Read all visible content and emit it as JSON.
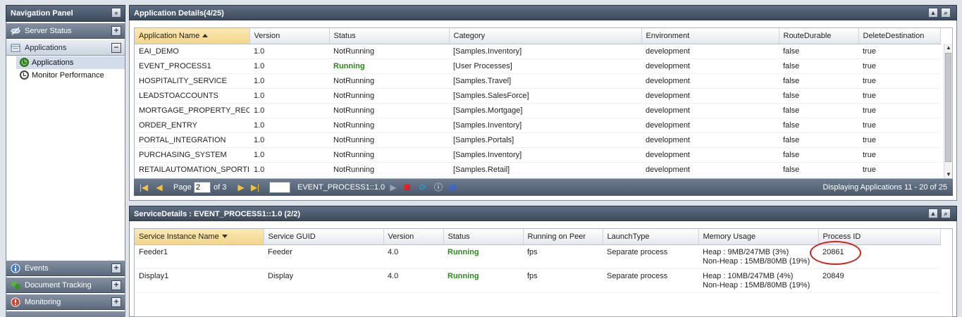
{
  "nav": {
    "title": "Navigation Panel",
    "sections": [
      {
        "label": "Server Status",
        "icon": "server-status-icon",
        "state": "+"
      },
      {
        "label": "Applications",
        "icon": "applications-icon",
        "state": "−"
      },
      {
        "label": "Events",
        "icon": "events-icon",
        "state": "+"
      },
      {
        "label": "Document Tracking",
        "icon": "document-tracking-icon",
        "state": "+"
      },
      {
        "label": "Monitoring",
        "icon": "monitoring-icon",
        "state": "+"
      }
    ],
    "items": [
      {
        "label": "Applications",
        "icon": "clock-icon",
        "selected": true
      },
      {
        "label": "Monitor Performance",
        "icon": "clock-icon",
        "selected": false
      }
    ]
  },
  "app_panel": {
    "title": "Application Details(4/25)",
    "columns": [
      "Application Name",
      "Version",
      "Status",
      "Category",
      "Environment",
      "RouteDurable",
      "DeleteDestination"
    ],
    "rows": [
      [
        "EAI_DEMO",
        "1.0",
        "NotRunning",
        "[Samples.Inventory]",
        "development",
        "false",
        "true"
      ],
      [
        "EVENT_PROCESS1",
        "1.0",
        "Running",
        "[User Processes]",
        "development",
        "false",
        "true"
      ],
      [
        "HOSPITALITY_SERVICE",
        "1.0",
        "NotRunning",
        "[Samples.Travel]",
        "development",
        "false",
        "true"
      ],
      [
        "LEADSTOACCOUNTS",
        "1.0",
        "NotRunning",
        "[Samples.SalesForce]",
        "development",
        "false",
        "true"
      ],
      [
        "MORTGAGE_PROPERTY_REC",
        "1.0",
        "NotRunning",
        "[Samples.Mortgage]",
        "development",
        "false",
        "true"
      ],
      [
        "ORDER_ENTRY",
        "1.0",
        "NotRunning",
        "[Samples.Inventory]",
        "development",
        "false",
        "true"
      ],
      [
        "PORTAL_INTEGRATION",
        "1.0",
        "NotRunning",
        "[Samples.Portals]",
        "development",
        "false",
        "true"
      ],
      [
        "PURCHASING_SYSTEM",
        "1.0",
        "NotRunning",
        "[Samples.Inventory]",
        "development",
        "false",
        "true"
      ],
      [
        "RETAILAUTOMATION_SPORTI",
        "1.0",
        "NotRunning",
        "[Samples.Retail]",
        "development",
        "false",
        "true"
      ]
    ],
    "pager": {
      "page_label": "Page",
      "page_value": "2",
      "of_label": "of 3",
      "selected_app": "EVENT_PROCESS1::1.0",
      "display_text": "Displaying Applications 11 - 20 of 25"
    }
  },
  "service_panel": {
    "title": "ServiceDetails : EVENT_PROCESS1::1.0 (2/2)",
    "columns": [
      "Service Instance Name",
      "Service GUID",
      "Version",
      "Status",
      "Running on Peer",
      "LaunchType",
      "Memory Usage",
      "Process ID"
    ],
    "rows": [
      {
        "name": "Feeder1",
        "guid": "Feeder",
        "version": "4.0",
        "status": "Running",
        "peer": "fps",
        "launch": "Separate process",
        "heap": "Heap : 9MB/247MB (3%)",
        "nonheap": "Non-Heap : 15MB/80MB (19%)",
        "pid": "20861"
      },
      {
        "name": "Display1",
        "guid": "Display",
        "version": "4.0",
        "status": "Running",
        "peer": "fps",
        "launch": "Separate process",
        "heap": "Heap : 10MB/247MB (4%)",
        "nonheap": "Non-Heap : 15MB/80MB (19%)",
        "pid": "20849"
      }
    ]
  },
  "colors": {
    "running": "#2a8a1c",
    "header_bar": "#4a586b",
    "annotation": "#d0201c"
  }
}
